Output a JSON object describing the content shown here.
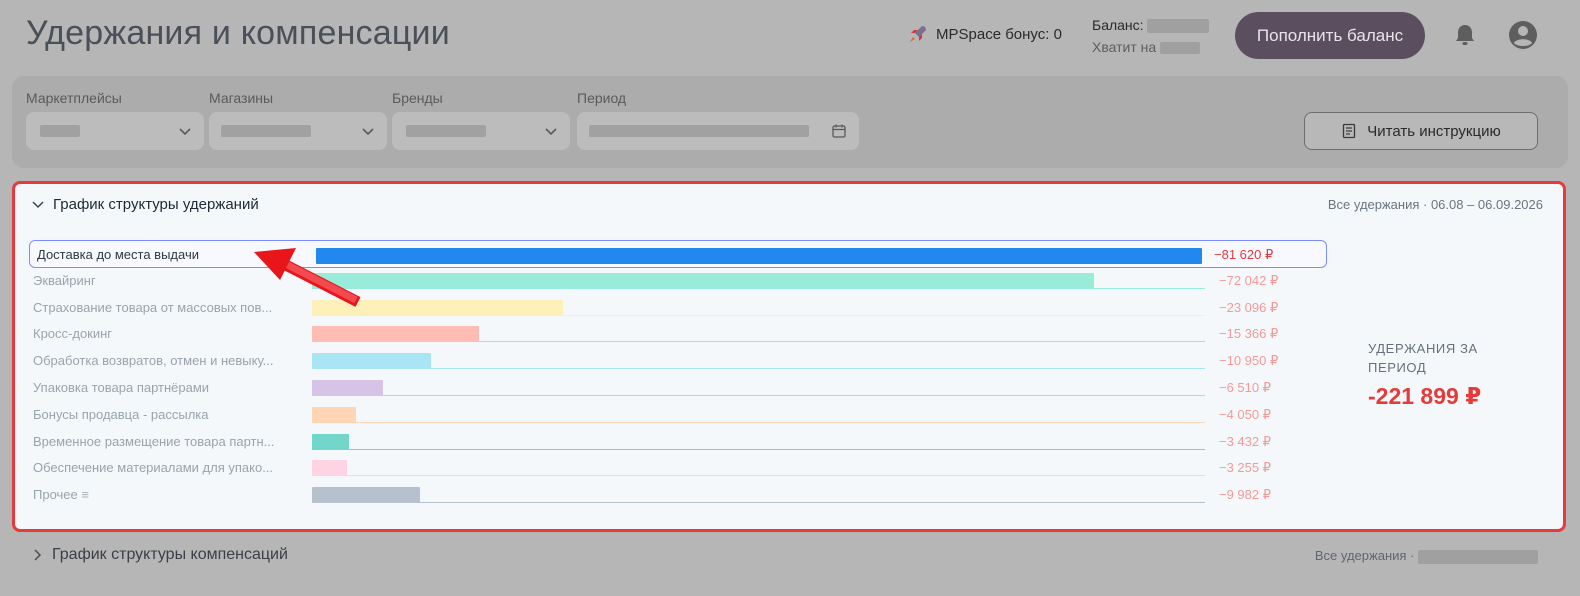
{
  "header": {
    "title": "Удержания и компенсации",
    "bonus_text": "MPSpace бонус: 0",
    "balance_label": "Баланс:",
    "enough_label": "Хватит на",
    "topup_label": "Пополнить баланс"
  },
  "filters": [
    {
      "label": "Маркетплейсы"
    },
    {
      "label": "Магазины"
    },
    {
      "label": "Бренды"
    },
    {
      "label": "Период"
    }
  ],
  "read_instruction_label": "Читать инструкцию",
  "panel": {
    "title": "График структуры удержаний",
    "range": "Все удержания · 06.08 – 06.09.2026",
    "total_label": "УДЕРЖАНИЯ ЗА ПЕРИОД",
    "total_value": "-221 899 ₽"
  },
  "chart_data": {
    "type": "bar",
    "orientation": "horizontal",
    "categories": [
      "Доставка до места выдачи",
      "Эквайринг",
      "Страхование товара от массовых пов...",
      "Кросс-докинг",
      "Обработка возвратов, отмен и невыку...",
      "Упаковка товара партнёрами",
      "Бонусы продавца - рассылка",
      "Временное размещение товара партн...",
      "Обеспечение материалами для упако...",
      "Прочее"
    ],
    "values": [
      81620,
      72042,
      23096,
      15366,
      10950,
      6510,
      4050,
      3432,
      3255,
      9982
    ],
    "value_labels": [
      "−81 620 ₽",
      "−72 042 ₽",
      "−23 096 ₽",
      "−15 366 ₽",
      "−10 950 ₽",
      "−6 510 ₽",
      "−4 050 ₽",
      "−3 432 ₽",
      "−3 255 ₽",
      "−9 982 ₽"
    ],
    "colors": [
      "#2288ee",
      "#98ecd9",
      "#fdf0b8",
      "#fdbcb4",
      "#a8e6f5",
      "#d6c3e8",
      "#ffd5b5",
      "#72d6ca",
      "#fed4e2",
      "#b7c1ce"
    ],
    "highlighted_index": 0,
    "xlim": [
      0,
      81620
    ]
  },
  "panel2": {
    "title": "График структуры компенсаций",
    "range": "Все удержания ·"
  }
}
